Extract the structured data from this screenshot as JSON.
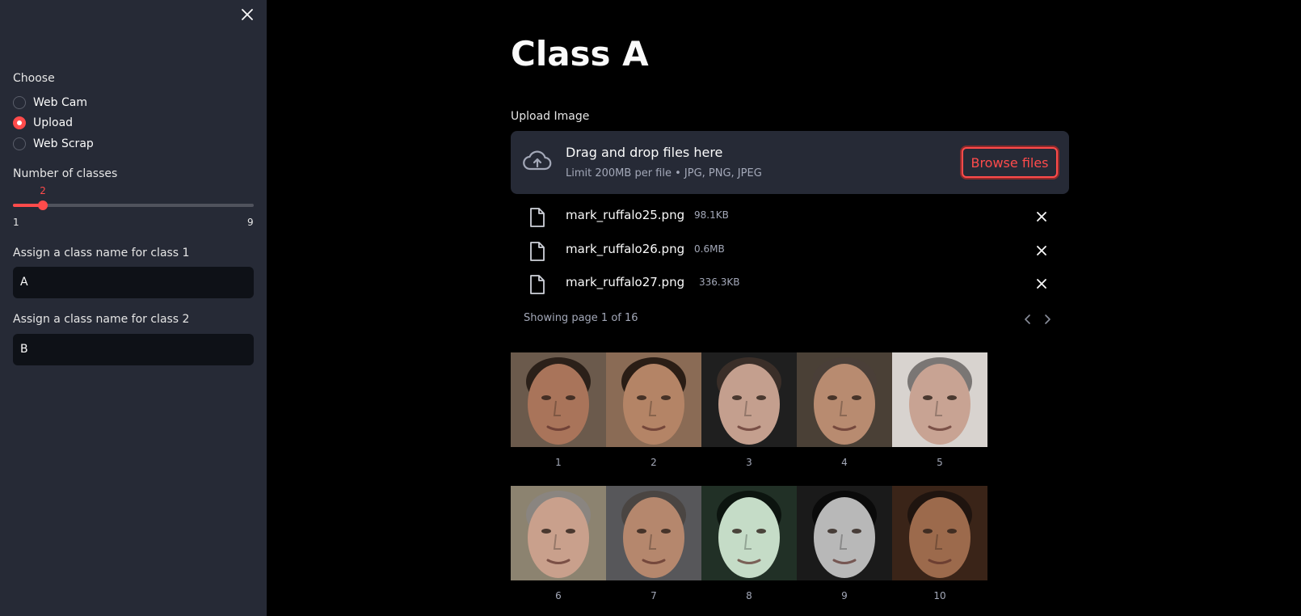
{
  "sidebar": {
    "choose_label": "Choose",
    "options": [
      {
        "label": "Web Cam",
        "selected": false
      },
      {
        "label": "Upload",
        "selected": true
      },
      {
        "label": "Web Scrap",
        "selected": false
      }
    ],
    "slider": {
      "label": "Number of classes",
      "value": 2,
      "min": 1,
      "max": 9,
      "min_label": "1",
      "max_label": "9",
      "value_label": "2"
    },
    "class_inputs": [
      {
        "label": "Assign a class name for class 1",
        "value": "A"
      },
      {
        "label": "Assign a class name for class 2",
        "value": "B"
      }
    ],
    "close_icon": "close-icon"
  },
  "main": {
    "title": "Class A",
    "upload_label": "Upload Image",
    "dropzone": {
      "main_text": "Drag and drop files here",
      "sub_text": "Limit 200MB per file • JPG, PNG, JPEG",
      "button_label": "Browse files",
      "icon": "cloud-upload-icon"
    },
    "files": [
      {
        "name": "mark_ruffalo25.png",
        "size": "98.1KB"
      },
      {
        "name": "mark_ruffalo26.png",
        "size": "0.6MB"
      },
      {
        "name": "mark_ruffalo27.png",
        "size": "336.3KB"
      }
    ],
    "pager_text": "Showing page 1 of 16",
    "gallery": [
      {
        "caption": "1",
        "skin": "#a9745a",
        "bg": "#6b5a4c",
        "hair": "#2b2019"
      },
      {
        "caption": "2",
        "skin": "#b48466",
        "bg": "#8a6b55",
        "hair": "#2a1d15"
      },
      {
        "caption": "3",
        "skin": "#c49f8e",
        "bg": "#1f1f1f",
        "hair": "#3a2e28"
      },
      {
        "caption": "4",
        "skin": "#b88b70",
        "bg": "#4a4036",
        "hair": "#4a3f38"
      },
      {
        "caption": "5",
        "skin": "#c8a393",
        "bg": "#d8d3cf",
        "hair": "#7a7674"
      },
      {
        "caption": "6",
        "skin": "#c9a08c",
        "bg": "#8c8370",
        "hair": "#8a8580"
      },
      {
        "caption": "7",
        "skin": "#b5876d",
        "bg": "#57575a",
        "hair": "#4a4542"
      },
      {
        "caption": "8",
        "skin": "#c5dcc7",
        "bg": "#213026",
        "hair": "#0c140f"
      },
      {
        "caption": "9",
        "skin": "#b8b8b8",
        "bg": "#1a1a1a",
        "hair": "#0a0a0a"
      },
      {
        "caption": "10",
        "skin": "#9c6a4c",
        "bg": "#3a2418",
        "hair": "#1f140f"
      }
    ]
  },
  "colors": {
    "accent": "#ff4b4b",
    "sidebar_bg": "#262a36",
    "main_bg": "#000000",
    "input_bg": "#0e1117"
  }
}
